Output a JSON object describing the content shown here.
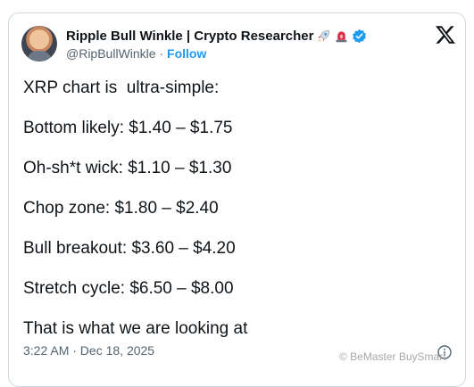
{
  "author": {
    "name": "Ripple Bull Winkle | Crypto Researcher",
    "handle": "@RipBullWinkle",
    "separator": "·",
    "follow_label": "Follow",
    "emojis": [
      "rocket-emoji",
      "police-light-emoji"
    ],
    "verified": true
  },
  "tweet": {
    "lines": [
      "XRP chart is  ultra-simple:",
      "Bottom likely: $1.40 – $1.75",
      "Oh-sh*t wick: $1.10 – $1.30",
      "Chop zone: $1.80 – $2.40",
      "Bull breakout: $3.60 – $4.20",
      "Stretch cycle: $6.50 – $8.00",
      "That is what we are looking at"
    ],
    "timestamp": "3:22 AM · Dec 18, 2025"
  },
  "watermark": "© BeMaster BuySmart",
  "icons": {
    "logo": "x-logo-icon",
    "verified": "verified-badge-icon",
    "info": "info-icon"
  },
  "colors": {
    "text": "#0f1419",
    "secondary": "#536471",
    "accent": "#1d9bf0",
    "border": "#cfd9de"
  }
}
